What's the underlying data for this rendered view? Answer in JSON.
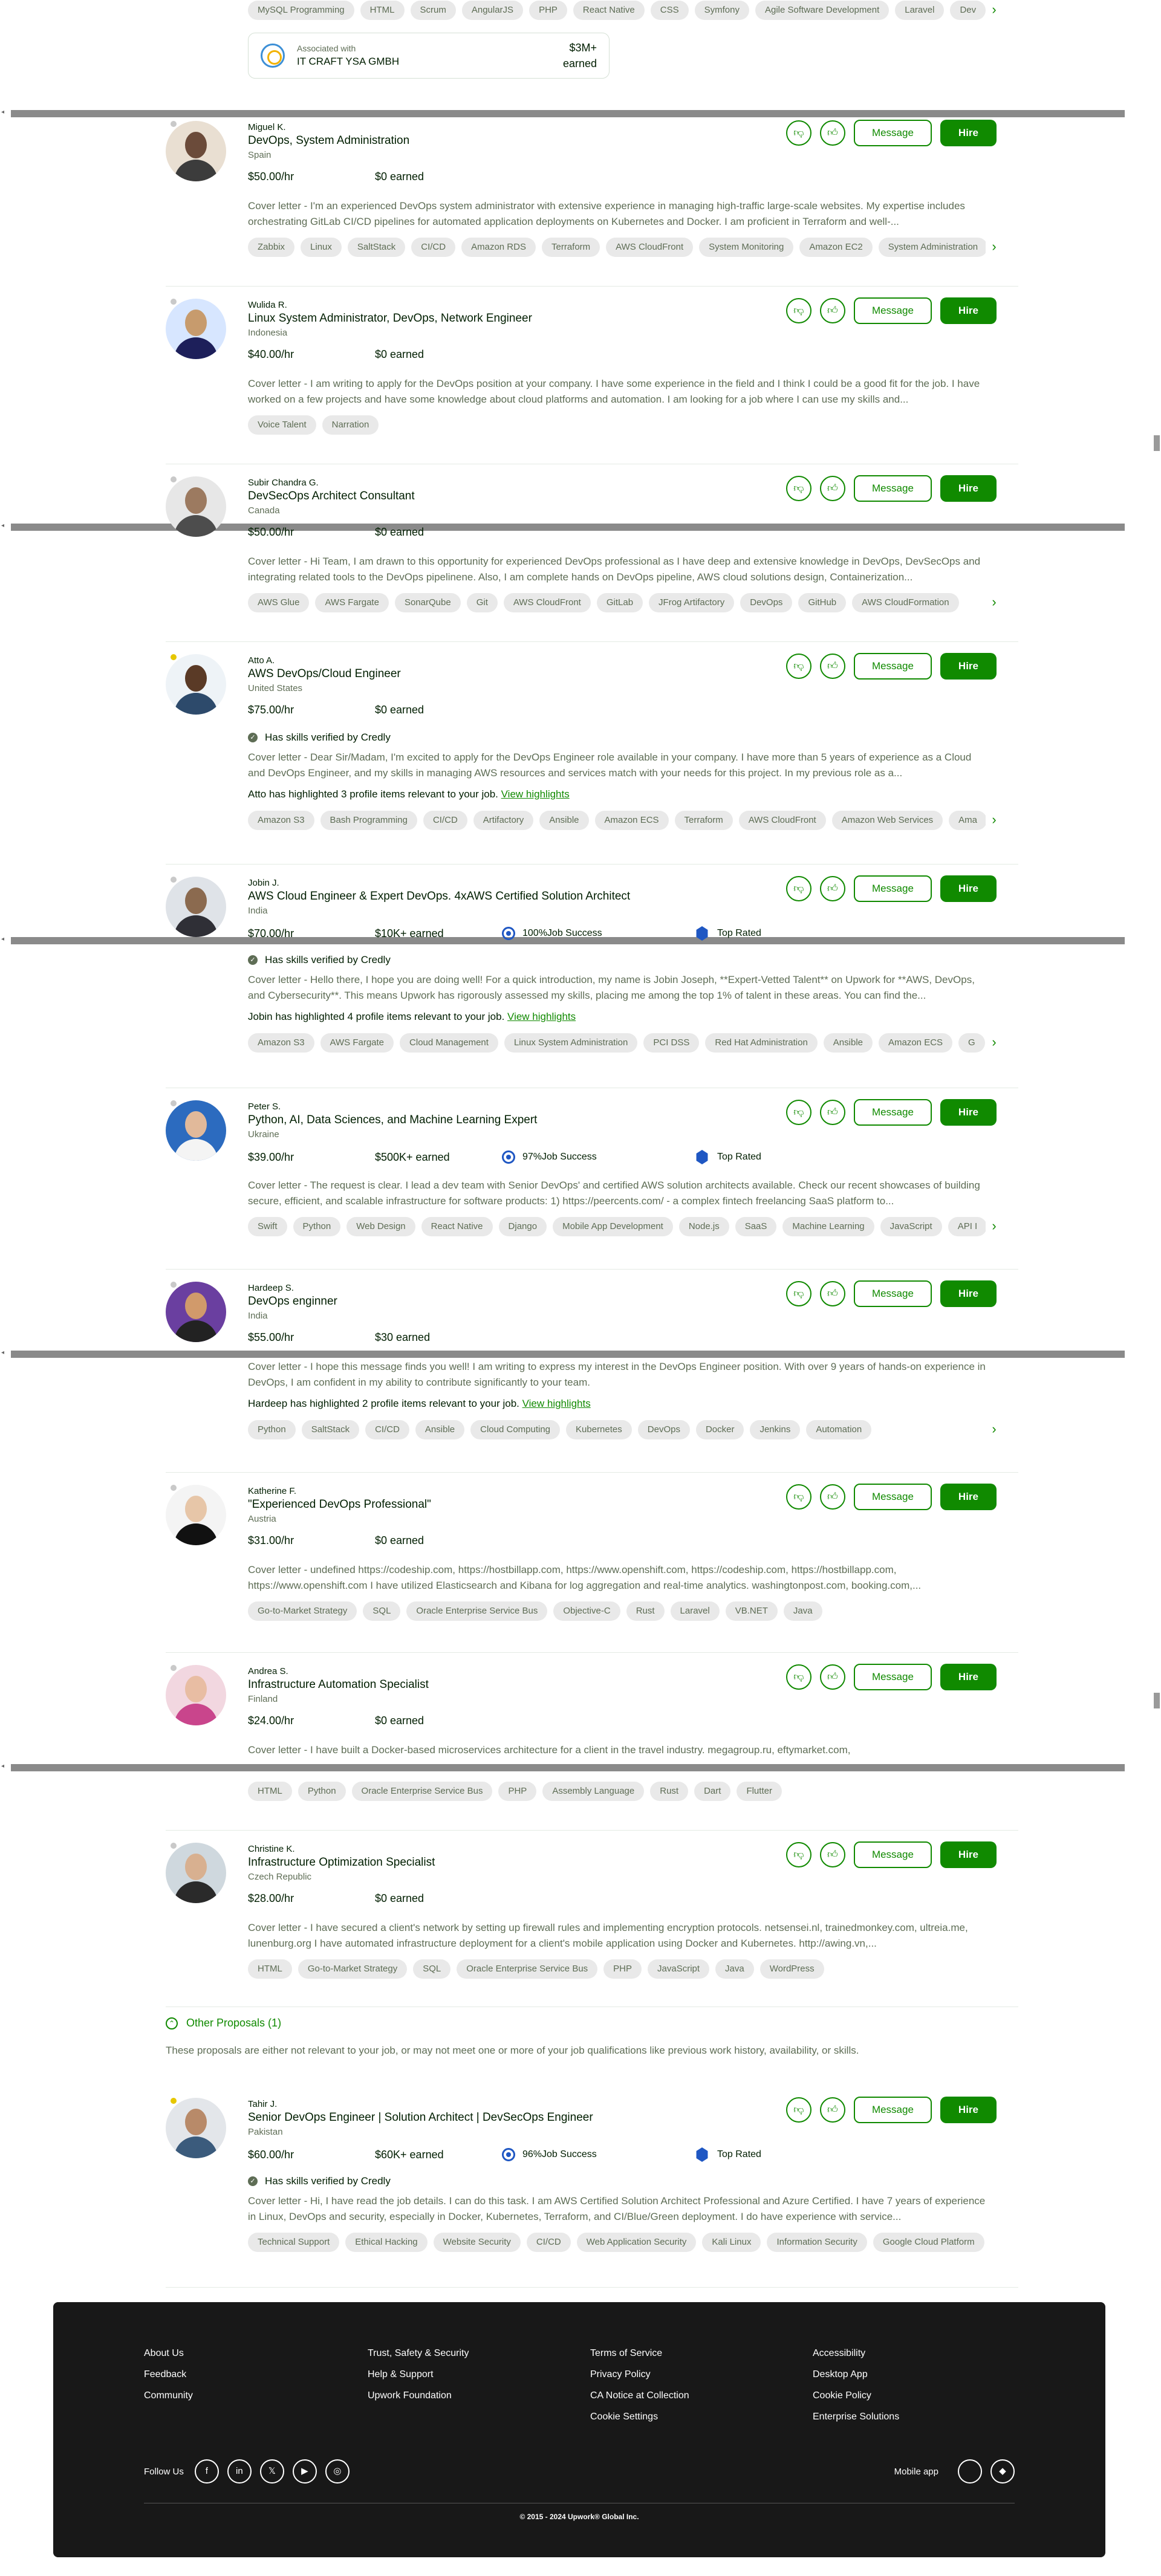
{
  "top_card": {
    "skills": [
      "MySQL Programming",
      "HTML",
      "Scrum",
      "AngularJS",
      "PHP",
      "React Native",
      "CSS",
      "Symfony",
      "Agile Software Development",
      "Laravel",
      "Dev"
    ],
    "associated_label": "Associated with",
    "agency_name": "IT CRAFT YSA GMBH",
    "earned_amount": "$3M+",
    "earned_label": "earned"
  },
  "labels": {
    "message": "Message",
    "hire": "Hire",
    "job_success_suffix": " Job Success",
    "top_rated": "Top Rated",
    "verified": "Has skills verified by Credly",
    "view_highlights": "View highlights"
  },
  "proposals": [
    {
      "name": "Miguel K.",
      "title": "DevOps, System Administration",
      "country": "Spain",
      "rate": "$50.00/hr",
      "earned": "$0 earned",
      "cover": "Cover letter - I'm an experienced DevOps system administrator with extensive experience in managing high-traffic large-scale websites. My expertise includes orchestrating GitLab CI/CD pipelines for automated application deployments on Kubernetes and Docker. I am proficient in Terraform and well-...",
      "skills": [
        "Zabbix",
        "Linux",
        "SaltStack",
        "CI/CD",
        "Amazon RDS",
        "Terraform",
        "AWS CloudFront",
        "System Monitoring",
        "Amazon EC2",
        "System Administration"
      ]
    },
    {
      "name": "Wulida R.",
      "title": "Linux System Administrator, DevOps, Network Engineer",
      "country": "Indonesia",
      "rate": "$40.00/hr",
      "earned": "$0 earned",
      "cover": "Cover letter - I am writing to apply for the DevOps position at your company. I have some experience in the field and I think I could be a good fit for the job. I have worked on a few projects and have some knowledge about cloud platforms and automation. I am looking for a job where I can use my skills and...",
      "skills": [
        "Voice Talent",
        "Narration"
      ]
    },
    {
      "name": "Subir Chandra G.",
      "title": "DevSecOps Architect Consultant",
      "country": "Canada",
      "rate": "$50.00/hr",
      "earned": "$0 earned",
      "cover": "Cover letter - Hi Team, I am drawn to this opportunity for experienced DevOps professional as I have deep and extensive knowledge in DevOps, DevSecOps and integrating related tools to the DevOps pipelinene. Also, I am complete hands on DevOps pipeline, AWS cloud solutions design, Containerization...",
      "skills": [
        "AWS Glue",
        "AWS Fargate",
        "SonarQube",
        "Git",
        "AWS CloudFront",
        "GitLab",
        "JFrog Artifactory",
        "DevOps",
        "GitHub",
        "AWS CloudFormation"
      ]
    },
    {
      "name": "Atto A.",
      "title": "AWS DevOps/Cloud Engineer",
      "country": "United States",
      "rate": "$75.00/hr",
      "earned": "$0 earned",
      "cover": "Cover letter - Dear Sir/Madam, I'm excited to apply for the DevOps Engineer role available in your company. I have more than 5 years of experience as a Cloud and DevOps Engineer, and my skills in managing AWS resources and services match with your needs for this project. In my previous role as a...",
      "highlight": "Atto has highlighted 3 profile items relevant to your job.",
      "skills": [
        "Amazon S3",
        "Bash Programming",
        "CI/CD",
        "Artifactory",
        "Ansible",
        "Amazon ECS",
        "Terraform",
        "AWS CloudFront",
        "Amazon Web Services",
        "Ama"
      ]
    },
    {
      "name": "Jobin J.",
      "title": "AWS Cloud Engineer & Expert DevOps. 4xAWS Certified Solution Architect",
      "country": "India",
      "rate": "$70.00/hr",
      "earned": "$10K+ earned",
      "job_success": "100%",
      "cover": "Cover letter - Hello there, I hope you are doing well! For a quick introduction, my name is Jobin Joseph, **Expert-Vetted Talent** on Upwork for **AWS, DevOps, and Cybersecurity**. This means Upwork has rigorously assessed my skills, placing me among the top 1% of talent in these areas. You can find the...",
      "highlight": "Jobin has highlighted 4 profile items relevant to your job.",
      "skills": [
        "Amazon S3",
        "AWS Fargate",
        "Cloud Management",
        "Linux System Administration",
        "PCI DSS",
        "Red Hat Administration",
        "Ansible",
        "Amazon ECS",
        "G"
      ]
    },
    {
      "name": "Peter S.",
      "title": "Python, AI, Data Sciences, and Machine Learning Expert",
      "country": "Ukraine",
      "rate": "$39.00/hr",
      "earned": "$500K+ earned",
      "job_success": "97%",
      "cover": "Cover letter - The request is clear. I lead a dev team with Senior DevOps' and certified AWS solution architects available. Check our recent showcases of building secure, efficient, and scalable infrastructure for software products: 1) https://peercents.com/ - a complex fintech freelancing SaaS platform to...",
      "skills": [
        "Swift",
        "Python",
        "Web Design",
        "React Native",
        "Django",
        "Mobile App Development",
        "Node.js",
        "SaaS",
        "Machine Learning",
        "JavaScript",
        "API I"
      ]
    },
    {
      "name": "Hardeep S.",
      "title": "DevOps enginner",
      "country": "India",
      "rate": "$55.00/hr",
      "earned": "$30 earned",
      "cover": "Cover letter - I hope this message finds you well! I am writing to express my interest in the DevOps Engineer position. With over 9 years of hands-on experience in DevOps, I am confident in my ability to contribute significantly to your team.",
      "highlight": "Hardeep has highlighted 2 profile items relevant to your job.",
      "skills": [
        "Python",
        "SaltStack",
        "CI/CD",
        "Ansible",
        "Cloud Computing",
        "Kubernetes",
        "DevOps",
        "Docker",
        "Jenkins",
        "Automation"
      ]
    },
    {
      "name": "Katherine F.",
      "title": "\"Experienced DevOps Professional\"",
      "country": "Austria",
      "rate": "$31.00/hr",
      "earned": "$0 earned",
      "cover": "Cover letter - undefined https://codeship.com, https://hostbillapp.com, https://www.openshift.com, https://codeship.com, https://hostbillapp.com, https://www.openshift.com I have utilized Elasticsearch and Kibana for log aggregation and real-time analytics. washingtonpost.com, booking.com,...",
      "skills": [
        "Go-to-Market Strategy",
        "SQL",
        "Oracle Enterprise Service Bus",
        "Objective-C",
        "Rust",
        "Laravel",
        "VB.NET",
        "Java"
      ]
    },
    {
      "name": "Andrea S.",
      "title": "Infrastructure Automation Specialist",
      "country": "Finland",
      "rate": "$24.00/hr",
      "earned": "$0 earned",
      "cover": "Cover letter - I have built a Docker-based microservices architecture for a client in the travel industry. megagroup.ru, eftymarket.com,",
      "skills": [
        "HTML",
        "Python",
        "Oracle Enterprise Service Bus",
        "PHP",
        "Assembly Language",
        "Rust",
        "Dart",
        "Flutter"
      ]
    },
    {
      "name": "Christine K.",
      "title": "Infrastructure Optimization Specialist",
      "country": "Czech Republic",
      "rate": "$28.00/hr",
      "earned": "$0 earned",
      "cover": "Cover letter - I have secured a client's network by setting up firewall rules and implementing encryption protocols. netsensei.nl, trainedmonkey.com, ultreia.me, lunenburg.org I have automated infrastructure deployment for a client's mobile application using Docker and Kubernetes. http://awing.vn,...",
      "skills": [
        "HTML",
        "Go-to-Market Strategy",
        "SQL",
        "Oracle Enterprise Service Bus",
        "PHP",
        "JavaScript",
        "Java",
        "WordPress"
      ]
    },
    {
      "name": "Tahir J.",
      "title": "Senior DevOps Engineer | Solution Architect | DevSecOps Engineer",
      "country": "Pakistan",
      "rate": "$60.00/hr",
      "earned": "$60K+ earned",
      "job_success": "96%",
      "cover": "Cover letter - Hi, I have read the job details. I can do this task. I am AWS Certified Solution Architect Professional and Azure Certified. I have 7 years of experience in Linux, DevOps and security, especially in Docker, Kubernetes, Terraform, and CI/Blue/Green deployment. I do have experience with service...",
      "skills": [
        "Technical Support",
        "Ethical Hacking",
        "Website Security",
        "CI/CD",
        "Web Application Security",
        "Kali Linux",
        "Information Security",
        "Google Cloud Platform"
      ]
    }
  ],
  "other_proposals": {
    "title": "Other Proposals (1)",
    "description": "These proposals are either not relevant to your job, or may not meet one or more of your job qualifications like previous work history, availability, or skills."
  },
  "footer": {
    "col1": [
      "About Us",
      "Feedback",
      "Community"
    ],
    "col2": [
      "Trust, Safety & Security",
      "Help & Support",
      "Upwork Foundation"
    ],
    "col3": [
      "Terms of Service",
      "Privacy Policy",
      "CA Notice at Collection",
      "Cookie Settings"
    ],
    "col4": [
      "Accessibility",
      "Desktop App",
      "Cookie Policy",
      "Enterprise Solutions"
    ],
    "follow_us": "Follow Us",
    "mobile_app": "Mobile app",
    "copyright": "© 2015 - 2024 Upwork® Global Inc."
  },
  "colors": {
    "brand_green": "#108a00",
    "text_muted": "#5e6d55",
    "footer_bg": "#181818",
    "scrollbar_grey": "#8a8a8a"
  }
}
